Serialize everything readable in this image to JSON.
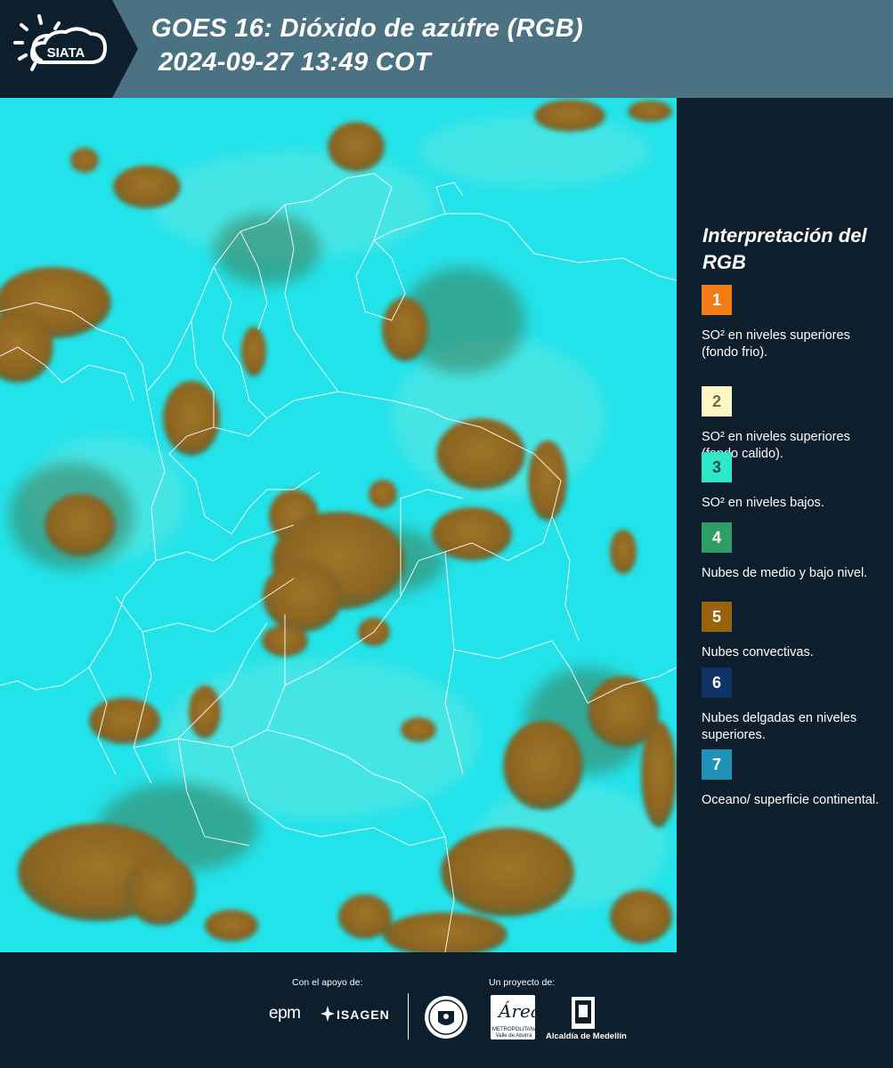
{
  "header": {
    "logo_text": "SIATA",
    "title_line1": "GOES 16: Dióxido de azúfre (RGB)",
    "title_line2": "2024-09-27 13:49 COT",
    "background_color": "#4b7282"
  },
  "map": {
    "product": "sulfur-dioxide-rgb-composite",
    "surface_color": "#22e3ea",
    "cloud_color": "#93691f",
    "boundary_color": "#ffffff"
  },
  "legend": {
    "title": "Interpretación del RGB",
    "items": [
      {
        "number": "1",
        "color": "#f47c16",
        "text_color": "#ffffff",
        "label": "SO² en niveles superiores (fondo frio)."
      },
      {
        "number": "2",
        "color": "#fff8c6",
        "text_color": "#7a6a3a",
        "label": "SO² en niveles superiores (fondo calido)."
      },
      {
        "number": "3",
        "color": "#2ee8c9",
        "text_color": "#1c4a45",
        "label": "SO² en niveles bajos."
      },
      {
        "number": "4",
        "color": "#2f9e66",
        "text_color": "#ffffff",
        "label": "Nubes de medio y bajo nivel."
      },
      {
        "number": "5",
        "color": "#99620f",
        "text_color": "#ffffff",
        "label": "Nubes convectivas."
      },
      {
        "number": "6",
        "color": "#0f3366",
        "text_color": "#ffffff",
        "label": "Nubes delgadas en niveles superiores."
      },
      {
        "number": "7",
        "color": "#1f93b5",
        "text_color": "#ffffff",
        "label": "Oceano/ superficie continental."
      }
    ]
  },
  "footer": {
    "support_label": "Con el apoyo de:",
    "project_label": "Un proyecto de:",
    "sponsors": [
      "epm",
      "ISAGEN"
    ],
    "partners": [
      "Área Metropolitana Valle de Aburrá",
      "Alcaldía de Medellín"
    ],
    "epm_text": "epm",
    "isagen_text": "ISAGEN",
    "area_script": "Área",
    "area_text": "METROPOLITANA Valle de Aburrá",
    "alcaldia_text": "Alcaldía de Medellín"
  }
}
